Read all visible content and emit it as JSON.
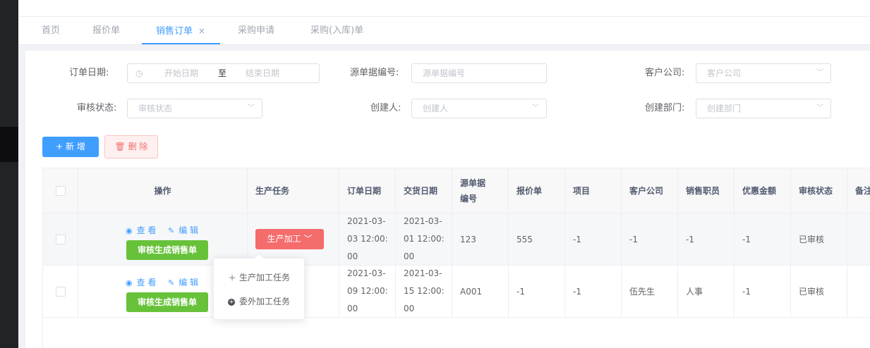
{
  "tabs": [
    {
      "label": "首页"
    },
    {
      "label": "报价单"
    },
    {
      "label": "销售订单",
      "close": "×"
    },
    {
      "label": "采购申请"
    },
    {
      "label": "采购(入库)单"
    }
  ],
  "filters": {
    "order_date_label": "订单日期:",
    "start_date_placeholder": "开始日期",
    "range_sep": "至",
    "end_date_placeholder": "结束日期",
    "source_no_label": "源单据编号:",
    "source_no_placeholder": "源单据编号",
    "customer_label": "客户公司:",
    "customer_placeholder": "客户公司",
    "audit_label": "审核状态:",
    "audit_placeholder": "审核状态",
    "creator_label": "创建人:",
    "creator_placeholder": "创建人",
    "dept_label": "创建部门:",
    "dept_placeholder": "创建部门"
  },
  "toolbar": {
    "add_label": "+ 新 增",
    "delete_label": "删 除"
  },
  "table": {
    "headers": {
      "ops": "操作",
      "task": "生产任务",
      "order_date": "订单日期",
      "delivery_date": "交货日期",
      "source_no": "源单据编号",
      "quote": "报价单",
      "project": "项目",
      "customer": "客户公司",
      "sales": "销售职员",
      "discount": "优惠金额",
      "audit": "审核状态",
      "remark": "备注"
    },
    "view_label": "查 看",
    "edit_label": "编 辑",
    "audit_btn_label": "审核生成销售单",
    "produce_btn_label": "生产加工",
    "rows": [
      {
        "order_date": "2021-03-03 12:00:00",
        "delivery_date": "2021-03-01 12:00:00",
        "source_no": "123",
        "quote": "555",
        "project": "-1",
        "customer": "-1",
        "sales": "-1",
        "discount": "-1",
        "audit": "已审核"
      },
      {
        "order_date": "2021-03-09 12:00:00",
        "delivery_date": "2021-03-15 12:00:00",
        "source_no": "A001",
        "quote": "-1",
        "project": "-1",
        "customer": "伍先生",
        "sales": "人事",
        "discount": "-1",
        "audit": "已审核"
      }
    ]
  },
  "dropdown": {
    "items": [
      {
        "label": "生产加工任务",
        "icon": "plus-icon"
      },
      {
        "label": "委外加工任务",
        "icon": "plus-circle-icon"
      }
    ]
  },
  "colors": {
    "primary": "#409eff",
    "danger": "#f56c6c",
    "success": "#67c23a"
  }
}
